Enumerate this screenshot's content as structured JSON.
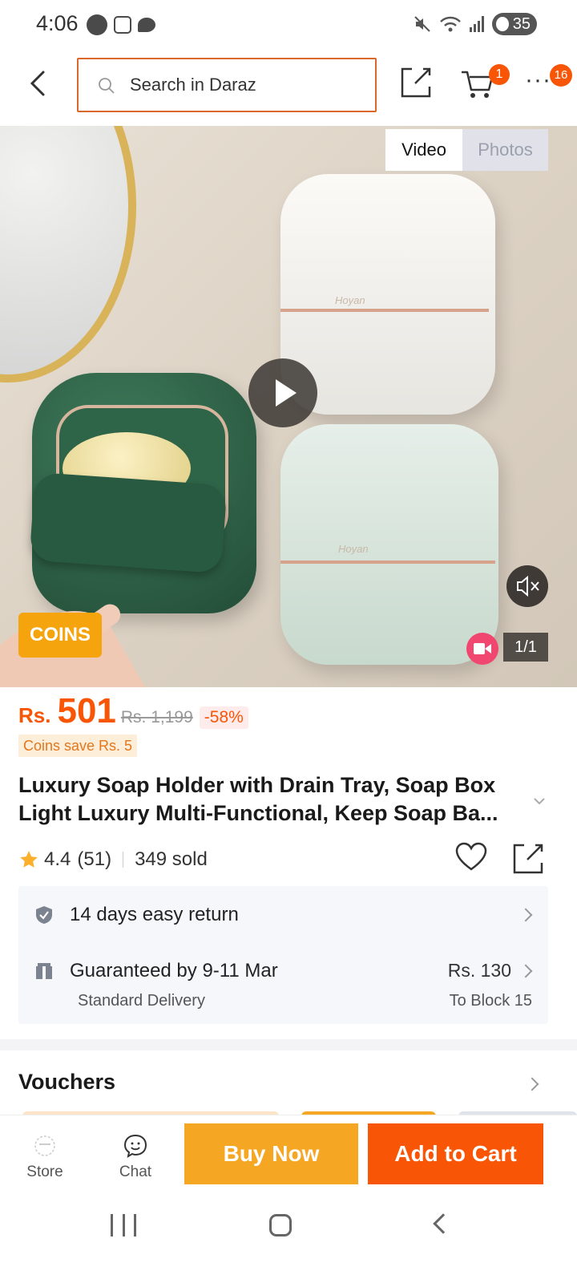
{
  "status_bar": {
    "time": "4:06",
    "battery": "35"
  },
  "header": {
    "search_placeholder": "Search in Daraz",
    "cart_count": "1",
    "more_count": "16",
    "accent_color": "#f85606"
  },
  "media": {
    "tabs": [
      {
        "label": "Video",
        "active": true
      },
      {
        "label": "Photos",
        "active": false
      }
    ],
    "coins_label": "COINS",
    "counter": "1/1",
    "brand_text": "Hoyan"
  },
  "price": {
    "currency": "Rs.",
    "current": "501",
    "original": "Rs. 1,199",
    "discount": "-58%",
    "coins_save": "Coins save Rs. 5"
  },
  "product": {
    "title": "Luxury Soap Holder with Drain Tray, Soap Box Light Luxury Multi-Functional, Keep Soap Ba..."
  },
  "rating": {
    "score": "4.4",
    "count": "(51)",
    "sold": "349 sold"
  },
  "services": {
    "return": "14 days easy return",
    "delivery": "Guaranteed by 9-11 Mar",
    "delivery_type": "Standard Delivery",
    "delivery_fee": "Rs. 130",
    "delivery_to": "To Block 15"
  },
  "vouchers": {
    "title": "Vouchers"
  },
  "bottom_bar": {
    "store_label": "Store",
    "chat_label": "Chat",
    "buy_now": "Buy Now",
    "add_to_cart": "Add to Cart",
    "buy_color": "#f5a623",
    "cart_color": "#f85606"
  }
}
